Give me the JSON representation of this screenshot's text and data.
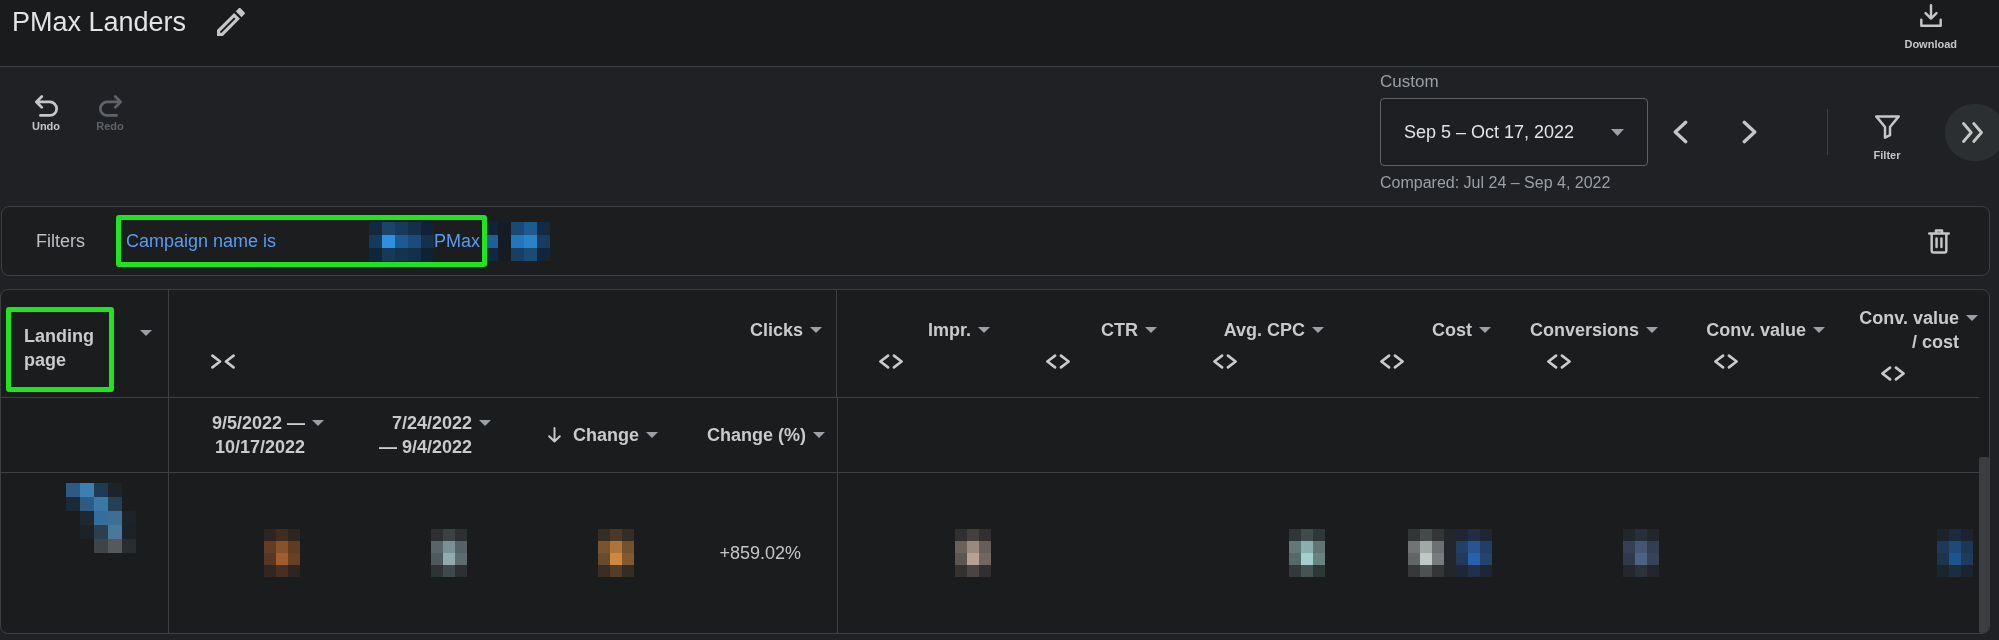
{
  "header": {
    "title": "PMax Landers",
    "actions": [
      {
        "kind": "download",
        "label": "Download"
      }
    ]
  },
  "toolbar": {
    "history": [
      {
        "kind": "undo",
        "label": "Undo",
        "disabled": false
      },
      {
        "kind": "redo",
        "label": "Redo",
        "disabled": true
      }
    ],
    "date_range": {
      "label": "Custom",
      "value": "Sep 5 – Oct 17, 2022",
      "comparison": "Compared: Jul 24 – Sep 4, 2022"
    },
    "filter_button": {
      "label": "Filter"
    }
  },
  "filters": {
    "label": "Filters",
    "chips": [
      {
        "parts": [
          {
            "kind": "text",
            "text": "Campaign name is",
            "highlighted": true
          },
          {
            "kind": "redacted",
            "highlighted": true
          },
          {
            "kind": "text",
            "text": "PMax",
            "highlighted": true
          },
          {
            "kind": "redacted",
            "highlighted": false
          }
        ]
      }
    ]
  },
  "table": {
    "dimension": {
      "label": "Landing page",
      "highlighted": true
    },
    "groups": [
      {
        "label": "Clicks",
        "expanded": true,
        "columns": [
          {
            "label": "9/5/2022 — 10/17/2022",
            "sorted": false
          },
          {
            "label": "7/24/2022 — 9/4/2022",
            "sorted": false
          },
          {
            "label": "Change",
            "sorted": true
          },
          {
            "label": "Change (%)",
            "sorted": false
          }
        ]
      },
      {
        "label": "Impr.",
        "expanded": false
      },
      {
        "label": "CTR",
        "expanded": false
      },
      {
        "label": "Avg. CPC",
        "expanded": false
      },
      {
        "label": "Cost",
        "expanded": false
      },
      {
        "label": "Conversions",
        "expanded": false
      },
      {
        "label": "Conv. value",
        "expanded": false
      },
      {
        "label": "Conv. value / cost",
        "expanded": false
      }
    ],
    "rows": [
      {
        "dimension": {
          "kind": "redacted"
        },
        "cells": [
          {
            "kind": "redacted"
          },
          {
            "kind": "redacted"
          },
          {
            "kind": "redacted"
          },
          {
            "kind": "text",
            "text": "+859.02%"
          },
          {
            "kind": "redacted"
          },
          {
            "kind": "blank"
          },
          {
            "kind": "redacted"
          },
          {
            "kind": "redacted"
          },
          {
            "kind": "redacted"
          },
          {
            "kind": "blank"
          },
          {
            "kind": "redacted"
          }
        ]
      }
    ]
  }
}
